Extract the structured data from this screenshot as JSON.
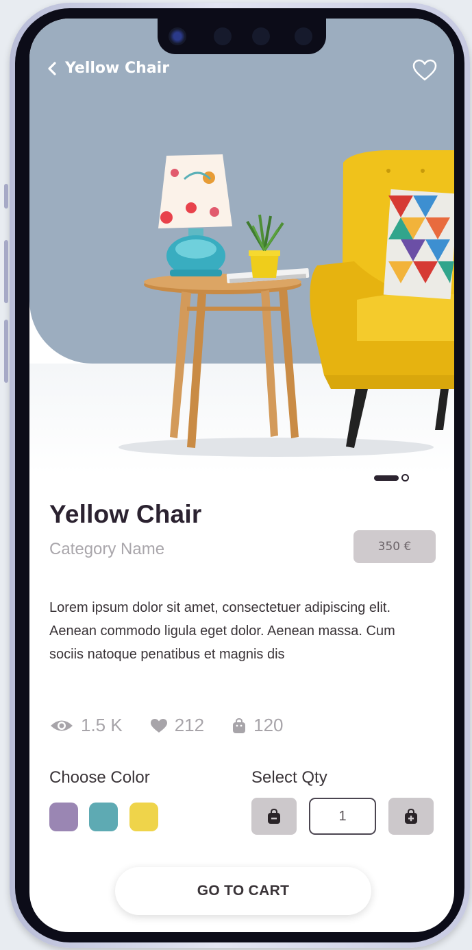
{
  "header": {
    "back_label": "Yellow Chair",
    "back_icon": "chevron-left-icon",
    "favorite_icon": "heart-outline-icon"
  },
  "carousel": {
    "active_index": 0,
    "total": 2
  },
  "product": {
    "title": "Yellow Chair",
    "category": "Category Name",
    "price": "350 €",
    "description": "Lorem ipsum dolor sit amet, consectetuer adipiscing elit. Aenean commodo ligula eget dolor. Aenean massa. Cum sociis natoque penatibus et magnis dis"
  },
  "stats": [
    {
      "icon": "eye-icon",
      "value": "1.5 K"
    },
    {
      "icon": "heart-icon",
      "value": "212"
    },
    {
      "icon": "shopping-bag-icon",
      "value": "120"
    }
  ],
  "color_section": {
    "label": "Choose Color",
    "colors": [
      "#9a86b3",
      "#5eaab3",
      "#efd44a"
    ]
  },
  "qty_section": {
    "label": "Select Qty",
    "value": "1",
    "decrease_icon": "bag-minus-icon",
    "increase_icon": "bag-plus-icon"
  },
  "cart_button": {
    "label": "GO TO CART"
  },
  "theme": {
    "hero_bg": "#9cadbf",
    "chair": "#f0c21b",
    "price_bg": "#cfcacd",
    "text_dark": "#2b2230"
  }
}
